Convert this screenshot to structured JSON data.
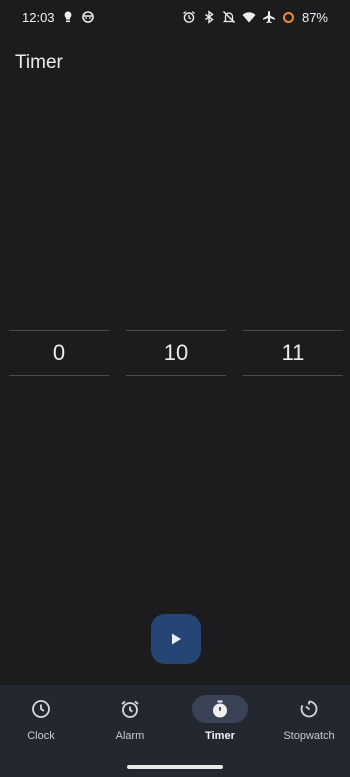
{
  "status_bar": {
    "time": "12:03",
    "battery": "87%",
    "left_icons": [
      "bulb-notification-icon",
      "face-notification-icon"
    ],
    "right_icons": [
      "alarm-icon",
      "bluetooth-icon",
      "notifications-off-icon",
      "wifi-icon",
      "airplane-icon",
      "battery-ring-icon"
    ],
    "battery_color": "#f08a35"
  },
  "page": {
    "title": "Timer"
  },
  "picker": {
    "hours": "0",
    "minutes": "10",
    "seconds": "11"
  },
  "fab": {
    "icon": "play-icon",
    "color": "#254575"
  },
  "bottom_nav": {
    "items": [
      {
        "label": "Clock",
        "icon": "clock-icon"
      },
      {
        "label": "Alarm",
        "icon": "alarm-icon"
      },
      {
        "label": "Timer",
        "icon": "timer-icon",
        "active": true
      },
      {
        "label": "Stopwatch",
        "icon": "stopwatch-icon"
      }
    ]
  },
  "colors": {
    "background": "#1c1c1e",
    "nav_background": "#232830",
    "active_pill": "#3a4356"
  }
}
